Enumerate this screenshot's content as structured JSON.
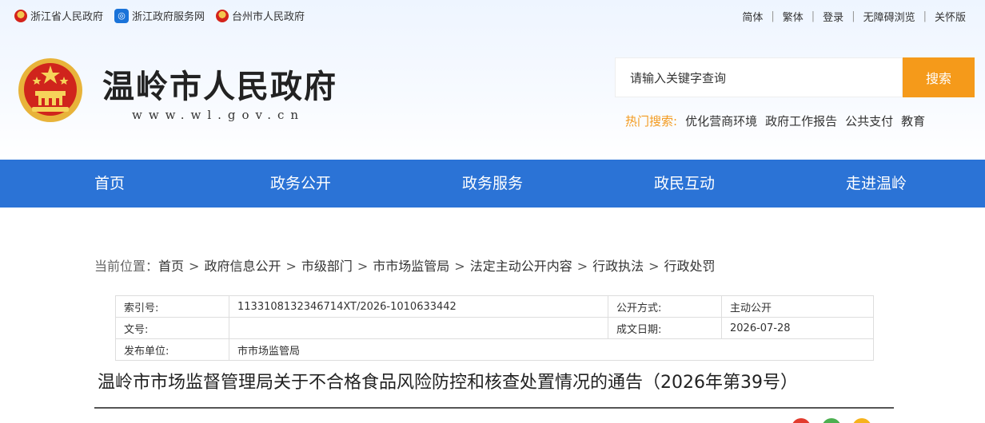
{
  "topbar": {
    "left_links": [
      "浙江省人民政府",
      "浙江政府服务网",
      "台州市人民政府"
    ],
    "right_links": [
      "简体",
      "繁体",
      "登录",
      "无障碍浏览",
      "关怀版"
    ],
    "separator": "|"
  },
  "header": {
    "title": "温岭市人民政府",
    "url": "www.wl.gov.cn",
    "search_placeholder": "请输入关键字查询",
    "search_button": "搜索",
    "hot_label": "热门搜索:",
    "hot_items": [
      "优化营商环境",
      "政府工作报告",
      "公共支付",
      "教育"
    ]
  },
  "nav": {
    "items": [
      "首页",
      "政务公开",
      "政务服务",
      "政民互动",
      "走进温岭"
    ]
  },
  "breadcrumb": {
    "lead": "当前位置：",
    "items": [
      "首页",
      "政府信息公开",
      "市级部门",
      "市市场监管局",
      "法定主动公开内容",
      "行政执法",
      "行政处罚"
    ],
    "sep": ">"
  },
  "meta": {
    "index_label": "索引号:",
    "index_value": "1133108132346714XT/2026-1010633442",
    "open_label": "公开方式:",
    "open_value": "主动公开",
    "doc_label": "文号:",
    "doc_value": "",
    "date_label": "成文日期:",
    "date_value": "2026-07-28",
    "pub_label": "发布单位:",
    "pub_value": "市市场监管局"
  },
  "article": {
    "title": "温岭市市场监督管理局关于不合格食品风险防控和核查处置情况的通告（2026年第39号）"
  },
  "colors": {
    "nav": "#2b73d6",
    "search_button": "#f59a1a",
    "hot_label": "#f39a1e",
    "share_dots": [
      "#e23b2e",
      "#4caf50",
      "#f6b21b"
    ]
  }
}
